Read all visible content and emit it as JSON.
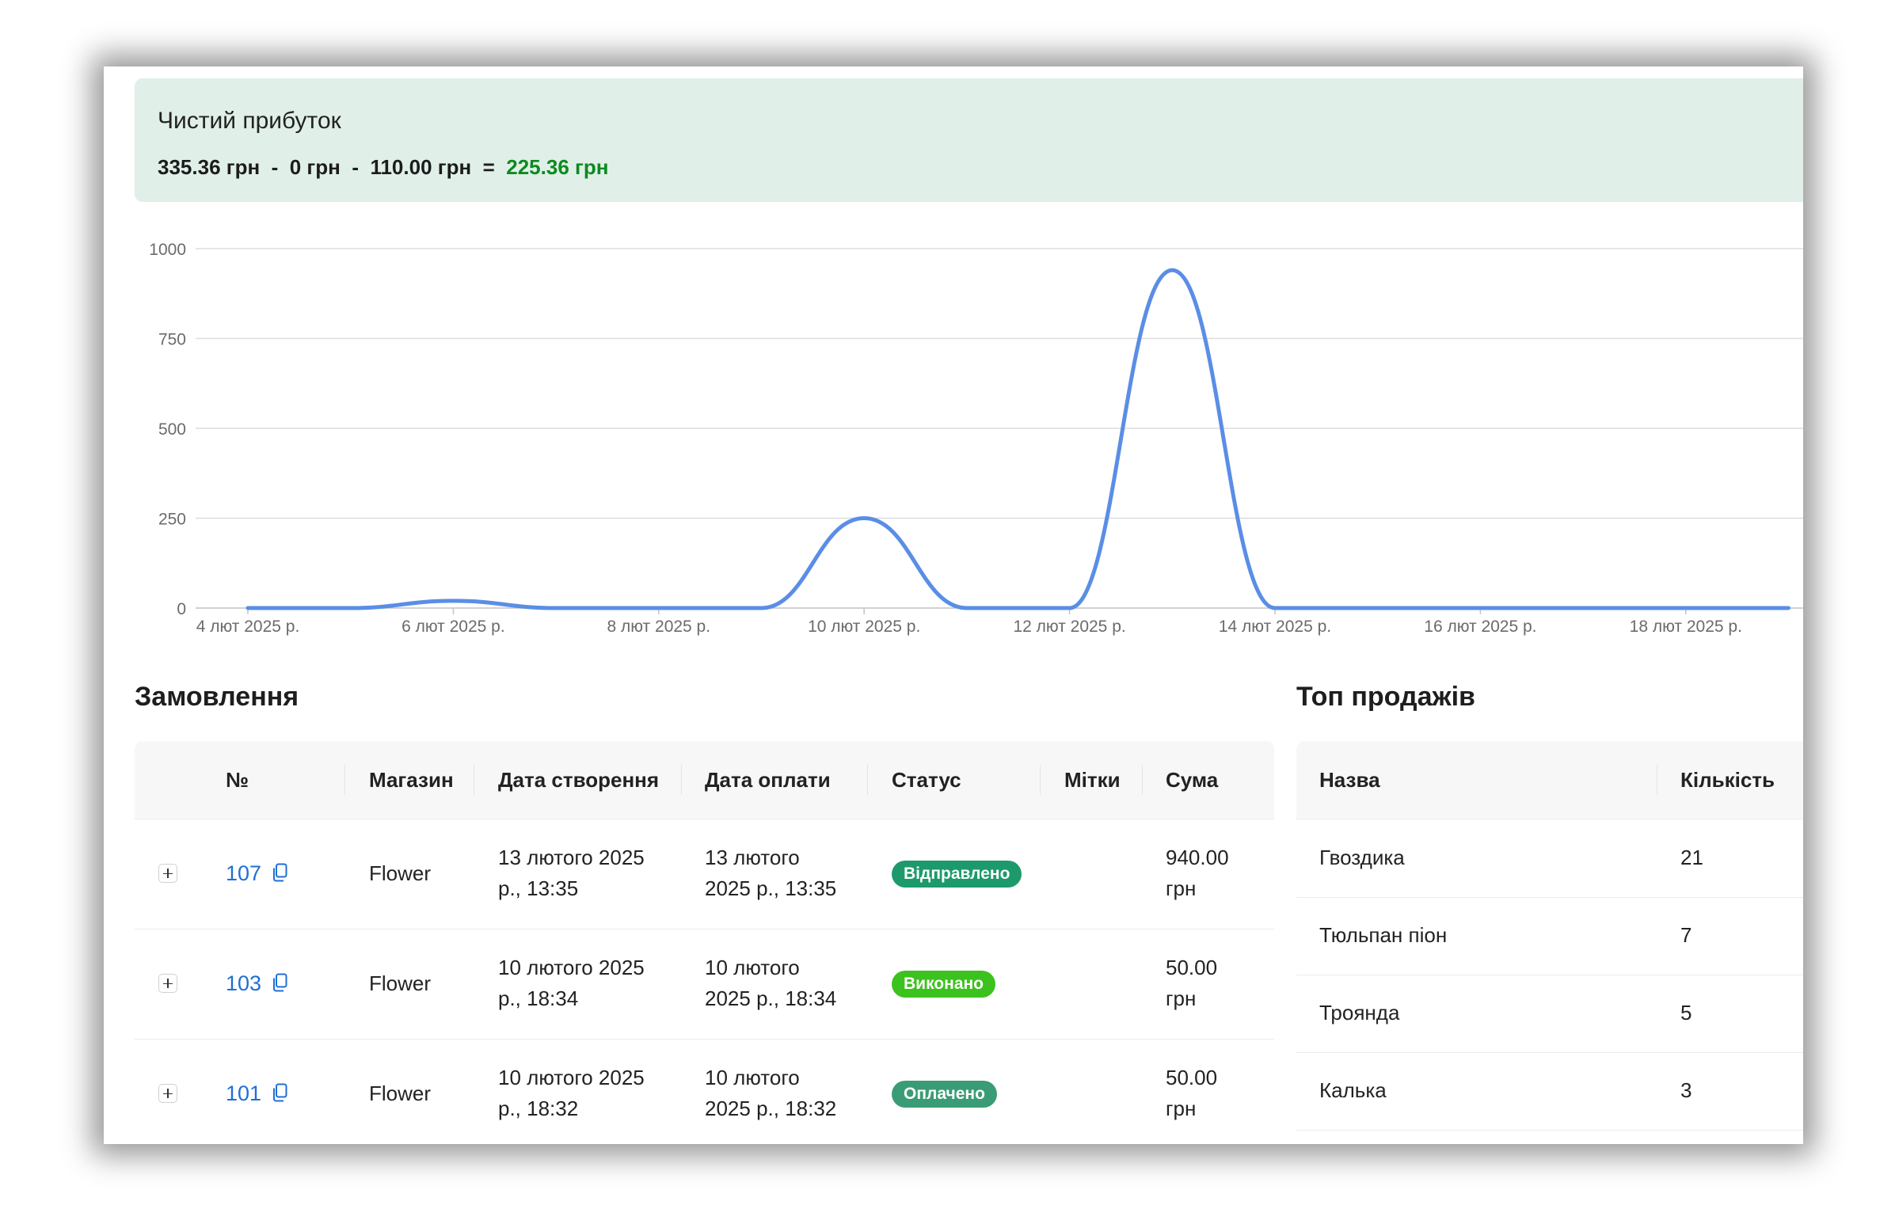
{
  "profit": {
    "title": "Чистий прибуток",
    "income": "335.36 грн",
    "op1": "-",
    "expense1": "0 грн",
    "op2": "-",
    "expense2": "110.00 грн",
    "eq": "=",
    "result": "225.36 грн",
    "result_color": "#0d8a1f",
    "background": "#e0efe8"
  },
  "chart_data": {
    "type": "line",
    "title": "",
    "xlabel": "",
    "ylabel": "",
    "line_color": "#5a8ee6",
    "grid": true,
    "ylim": [
      0,
      1000
    ],
    "y_ticks": [
      "0",
      "250",
      "500",
      "750",
      "1000"
    ],
    "x_ticks": [
      "4 лют 2025 р.",
      "6 лют 2025 р.",
      "8 лют 2025 р.",
      "10 лют 2025 р.",
      "12 лют 2025 р.",
      "14 лют 2025 р.",
      "16 лют 2025 р.",
      "18 лют 2025 р."
    ],
    "x": [
      "4 лют 2025 р.",
      "5 лют 2025 р.",
      "6 лют 2025 р.",
      "7 лют 2025 р.",
      "8 лют 2025 р.",
      "9 лют 2025 р.",
      "10 лют 2025 р.",
      "11 лют 2025 р.",
      "12 лют 2025 р.",
      "13 лют 2025 р.",
      "14 лют 2025 р.",
      "15 лют 2025 р.",
      "16 лют 2025 р.",
      "17 лют 2025 р.",
      "18 лют 2025 р.",
      "19 лют 2025 р."
    ],
    "series": [
      {
        "values": [
          0,
          0,
          20,
          0,
          0,
          0,
          250,
          0,
          0,
          940,
          0,
          0,
          0,
          0,
          0,
          0
        ]
      }
    ]
  },
  "orders": {
    "title": "Замовлення",
    "columns": [
      "№",
      "Магазин",
      "Дата створення",
      "Дата оплати",
      "Статус",
      "Мітки",
      "Сума"
    ],
    "rows": [
      {
        "number": "107",
        "store": "Flower",
        "created_1": "13 лютого 2025",
        "created_2": "р., 13:35",
        "paid_1": "13 лютого",
        "paid_2": "2025 р., 13:35",
        "status": "Відправлено",
        "status_color": "#1d9a6c",
        "tags": "",
        "sum_1": "940.00",
        "sum_2": "грн"
      },
      {
        "number": "103",
        "store": "Flower",
        "created_1": "10 лютого 2025",
        "created_2": "р., 18:34",
        "paid_1": "10 лютого",
        "paid_2": "2025 р., 18:34",
        "status": "Виконано",
        "status_color": "#3cc21e",
        "tags": "",
        "sum_1": "50.00",
        "sum_2": "грн"
      },
      {
        "number": "101",
        "store": "Flower",
        "created_1": "10 лютого 2025",
        "created_2": "р., 18:32",
        "paid_1": "10 лютого",
        "paid_2": "2025 р., 18:32",
        "status": "Оплачено",
        "status_color": "#3a9c76",
        "tags": "",
        "sum_1": "50.00",
        "sum_2": "грн"
      }
    ]
  },
  "top_sales": {
    "title": "Топ продажів",
    "columns": [
      "Назва",
      "Кількість"
    ],
    "rows": [
      {
        "name": "Гвоздика",
        "qty": "21"
      },
      {
        "name": "Тюльпан піон",
        "qty": "7"
      },
      {
        "name": "Троянда",
        "qty": "5"
      },
      {
        "name": "Калька",
        "qty": "3"
      }
    ]
  },
  "icons": {
    "expand": "plus-square-icon",
    "copy": "copy-icon"
  }
}
